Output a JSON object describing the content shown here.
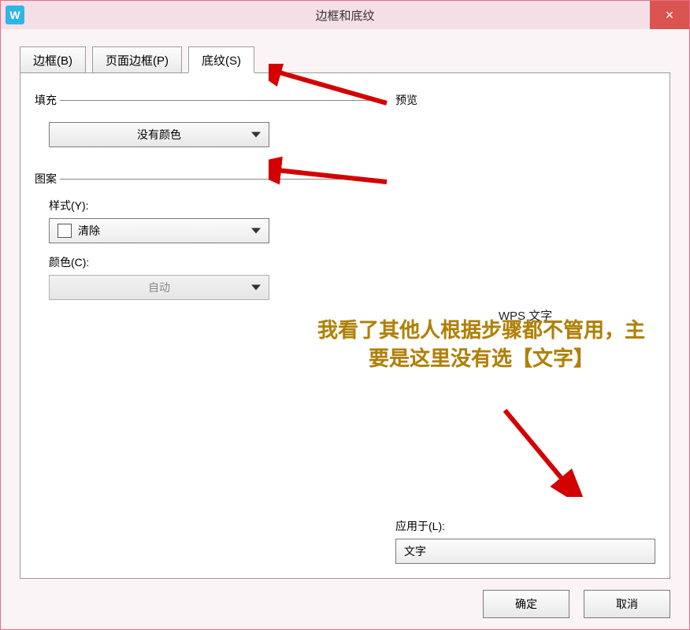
{
  "titlebar": {
    "app_icon_letter": "W",
    "title": "边框和底纹",
    "close_glyph": "×"
  },
  "tabs": {
    "border": "边框(B)",
    "page_border": "页面边框(P)",
    "shading": "底纹(S)",
    "active": "shading"
  },
  "shading": {
    "fill_section": "填充",
    "fill_value": "没有颜色",
    "pattern_section": "图案",
    "style_label": "样式(Y):",
    "style_value": "清除",
    "color_label": "颜色(C):",
    "color_value": "自动"
  },
  "preview": {
    "label": "预览",
    "content": "WPS 文字"
  },
  "apply": {
    "label": "应用于(L):",
    "value": "文字"
  },
  "buttons": {
    "ok": "确定",
    "cancel": "取消"
  },
  "annotations": {
    "text": "我看了其他人根据步骤都不管用，主要是这里没有选【文字】"
  }
}
